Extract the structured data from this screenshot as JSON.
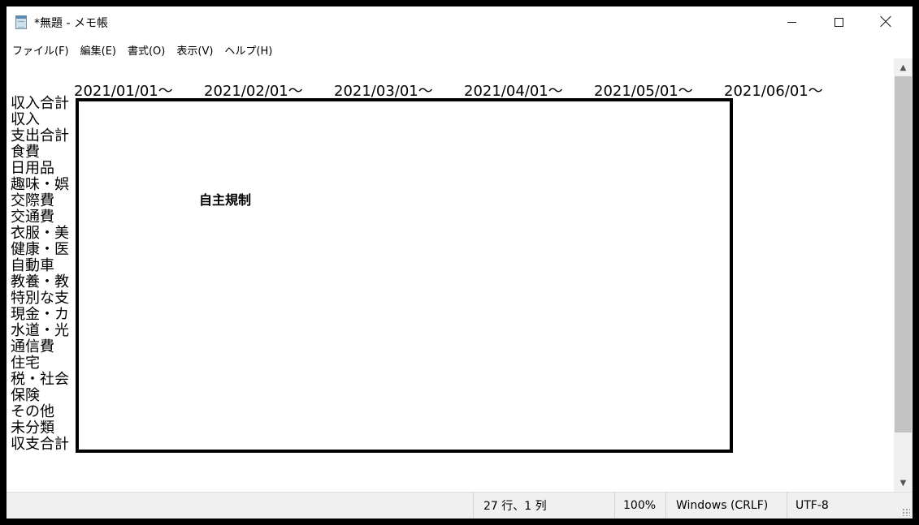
{
  "window": {
    "title": "*無題 - メモ帳",
    "controls": {
      "minimize": "",
      "maximize": "",
      "close": ""
    }
  },
  "menu": [
    "ファイル(F)",
    "編集(E)",
    "書式(O)",
    "表示(V)",
    "ヘルプ(H)"
  ],
  "editor": {
    "header_dates": [
      "2021/01/01～",
      "2021/02/01～",
      "2021/03/01～",
      "2021/04/01～",
      "2021/05/01～",
      "2021/06/01～"
    ],
    "row_labels": [
      "収入合計",
      "収入",
      "支出合計",
      "食費",
      "日用品",
      "趣味・娯",
      "交際費",
      "交通費",
      "衣服・美",
      "健康・医",
      "自動車",
      "教養・教",
      "特別な支",
      "現金・カ",
      "水道・光",
      "通信費",
      "住宅",
      "税・社会",
      "保険",
      "その他",
      "未分類",
      "収支合計"
    ],
    "overlay_label": "自主規制"
  },
  "status": {
    "position": "27 行、1 列",
    "zoom": "100%",
    "line_ending": "Windows (CRLF)",
    "encoding": "UTF-8"
  }
}
